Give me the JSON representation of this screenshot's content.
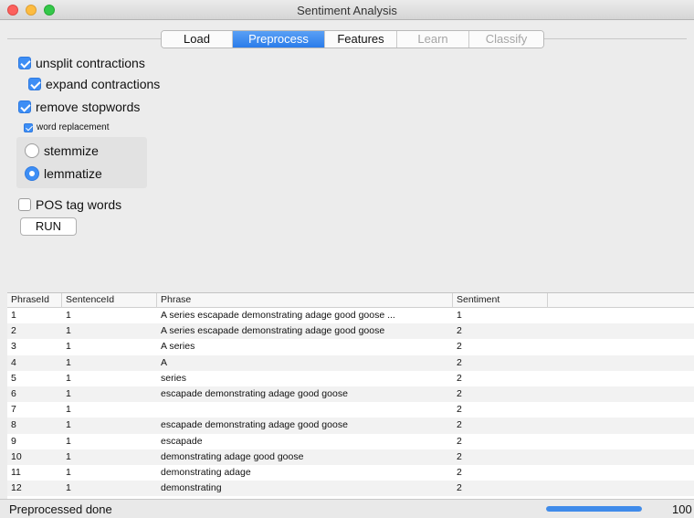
{
  "window": {
    "title": "Sentiment Analysis"
  },
  "tabs": [
    {
      "label": "Load",
      "state": "normal"
    },
    {
      "label": "Preprocess",
      "state": "active"
    },
    {
      "label": "Features",
      "state": "normal"
    },
    {
      "label": "Learn",
      "state": "disabled"
    },
    {
      "label": "Classify",
      "state": "disabled"
    }
  ],
  "options": {
    "unsplit_contractions": {
      "label": "unsplit contractions",
      "checked": true
    },
    "expand_contractions": {
      "label": "expand contractions",
      "checked": true
    },
    "remove_stopwords": {
      "label": "remove stopwords",
      "checked": true
    },
    "word_replacement": {
      "label": "word replacement",
      "checked": true
    },
    "stemmize": {
      "label": "stemmize",
      "selected": false
    },
    "lemmatize": {
      "label": "lemmatize",
      "selected": true
    },
    "pos_tag": {
      "label": "POS tag words",
      "checked": false
    },
    "run_label": "RUN"
  },
  "table": {
    "columns": [
      "PhraseId",
      "SentenceId",
      "Phrase",
      "Sentiment"
    ],
    "rows": [
      [
        "1",
        "1",
        "A series escapade demonstrating adage good goose ...",
        "1"
      ],
      [
        "2",
        "1",
        "A series escapade demonstrating adage good goose",
        "2"
      ],
      [
        "3",
        "1",
        "A series",
        "2"
      ],
      [
        "4",
        "1",
        "A",
        "2"
      ],
      [
        "5",
        "1",
        "series",
        "2"
      ],
      [
        "6",
        "1",
        "escapade demonstrating adage good goose",
        "2"
      ],
      [
        "7",
        "1",
        "",
        "2"
      ],
      [
        "8",
        "1",
        "escapade demonstrating adage good goose",
        "2"
      ],
      [
        "9",
        "1",
        "escapade",
        "2"
      ],
      [
        "10",
        "1",
        "demonstrating adage good goose",
        "2"
      ],
      [
        "11",
        "1",
        "demonstrating adage",
        "2"
      ],
      [
        "12",
        "1",
        "demonstrating",
        "2"
      ]
    ]
  },
  "status": {
    "text": "Preprocessed done",
    "progress_percent": 100,
    "progress_label": "100"
  },
  "colors": {
    "accent": "#3d8ef5",
    "close": "#fc605c",
    "minimize": "#fdbc40",
    "maximize": "#34c84a"
  }
}
